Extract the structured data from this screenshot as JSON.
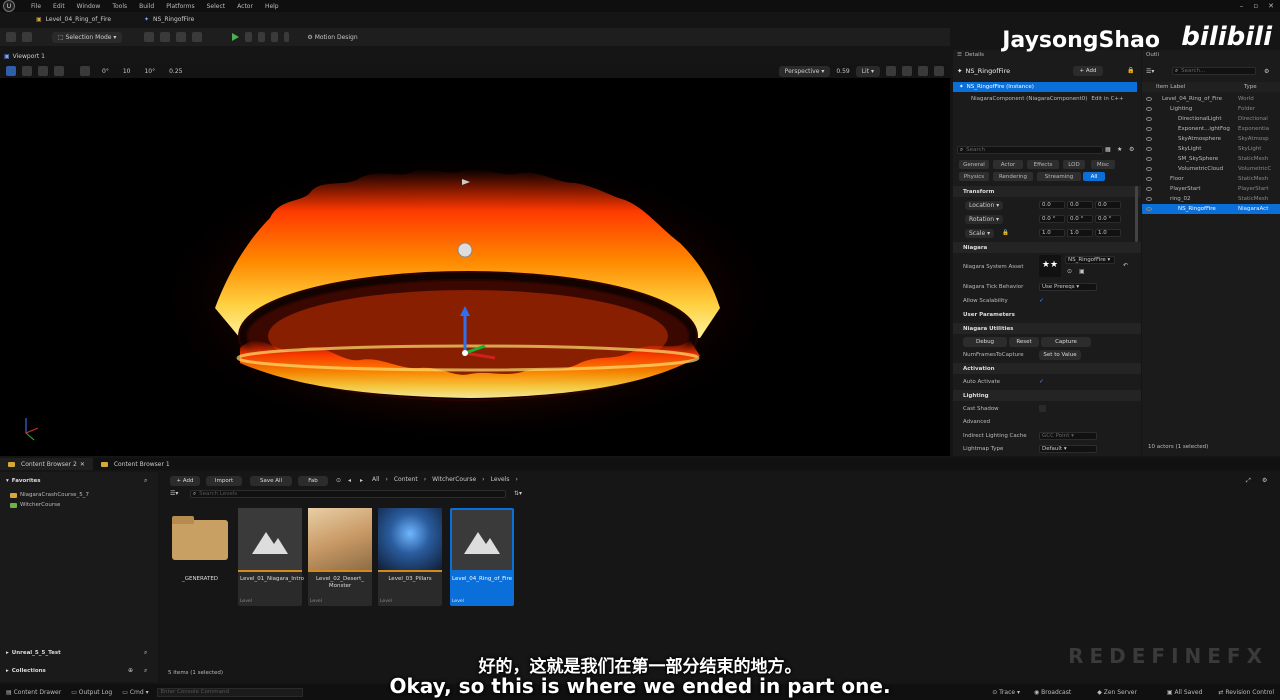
{
  "menu": [
    "File",
    "Edit",
    "Window",
    "Tools",
    "Build",
    "Platforms",
    "Select",
    "Actor",
    "Help"
  ],
  "window_tabs": [
    "Level_04_Ring_of_Fire",
    "NS_RingofFire"
  ],
  "toolbar": {
    "mode": "Selection Mode",
    "motion_design": "Motion Design"
  },
  "viewport": {
    "tab": "Viewport 1",
    "perspective": "Perspective",
    "fov": "0.59",
    "lit": "Lit",
    "snap_grid": "10",
    "snap_rot": "10°",
    "snap_scale": "0.25",
    "grid_val": "0°"
  },
  "details": {
    "tab": "Details",
    "object": "NS_RingofFire",
    "add": "+ Add",
    "instance": "NS_RingofFire (Instance)",
    "component": "NiagaraComponent (NiagaraComponent0)",
    "edit_in_cpp": "Edit in C++",
    "search_placeholder": "Search",
    "filters_row1": [
      "General",
      "Actor",
      "Effects",
      "LOD",
      "Misc"
    ],
    "filters_row2": [
      "Physics",
      "Rendering",
      "Streaming",
      "All"
    ],
    "transform_label": "Transform",
    "location": "Location",
    "rotation": "Rotation",
    "scale": "Scale",
    "loc_vals": [
      "0.0",
      "0.0",
      "0.0"
    ],
    "rot_vals": [
      "0.0 °",
      "0.0 °",
      "0.0 °"
    ],
    "scale_vals": [
      "1.0",
      "1.0",
      "1.0"
    ],
    "niagara_label": "Niagara",
    "system_asset": "Niagara System Asset",
    "system_asset_val": "NS_RingofFire",
    "tick_behavior": "Niagara Tick Behavior",
    "tick_behavior_val": "Use Prereqs",
    "allow_scalability": "Allow Scalability",
    "user_params": "User Parameters",
    "utilities": "Niagara Utilities",
    "debug": "Debug",
    "reset": "Reset",
    "capture": "Capture",
    "num_frames": "NumFramesToCapture",
    "set_to_value": "Set to Value",
    "activation": "Activation",
    "auto_activate": "Auto Activate",
    "lighting": "Lighting",
    "cast_shadow": "Cast Shadow",
    "advanced": "Advanced",
    "indirect_cache": "Indirect Lighting Cache",
    "indirect_cache_val": "GCC Point",
    "lightmap_type": "Lightmap Type",
    "lightmap_type_val": "Default"
  },
  "outliner": {
    "tab": "Outli",
    "search_placeholder": "Search...",
    "col_label": "Item Label",
    "col_type": "Type",
    "items": [
      {
        "label": "Level_04_Ring_of_Fire",
        "type": "World",
        "indent": 0
      },
      {
        "label": "Lighting",
        "type": "Folder",
        "indent": 1
      },
      {
        "label": "DirectionalLight",
        "type": "Directional",
        "indent": 2
      },
      {
        "label": "Exponent...ightFog",
        "type": "Exponentia",
        "indent": 2
      },
      {
        "label": "SkyAtmosphere",
        "type": "SkyAtmosp",
        "indent": 2
      },
      {
        "label": "SkyLight",
        "type": "SkyLight",
        "indent": 2
      },
      {
        "label": "SM_SkySphere",
        "type": "StaticMesh",
        "indent": 2
      },
      {
        "label": "VolumetricCloud",
        "type": "VolumetricC",
        "indent": 2
      },
      {
        "label": "Floor",
        "type": "StaticMesh",
        "indent": 1
      },
      {
        "label": "PlayerStart",
        "type": "PlayerStart",
        "indent": 1
      },
      {
        "label": "ring_02",
        "type": "StaticMesh",
        "indent": 1
      },
      {
        "label": "NS_RingofFire",
        "type": "NiagaraAct",
        "indent": 2
      }
    ],
    "count": "10 actors (1 selected)"
  },
  "content_browser": {
    "tabs": [
      "Content Browser 2",
      "Content Browser 1"
    ],
    "favorites": "Favorites",
    "fav_items": [
      "NiagaraCrashCourse_5_7",
      "WitcherCourse"
    ],
    "add": "+ Add",
    "import": "Import",
    "save_all": "Save All",
    "fab": "Fab",
    "breadcrumb": [
      "All",
      "Content",
      "WitcherCourse",
      "Levels"
    ],
    "search_placeholder": "Search Levels",
    "tiles": [
      {
        "name": "_GENERATED",
        "kind": ""
      },
      {
        "name": "Level_01_Niagara_Intro",
        "kind": "Level"
      },
      {
        "name": "Level_02_Desert_ Monster",
        "kind": "Level"
      },
      {
        "name": "Level_03_Pillars",
        "kind": "Level"
      },
      {
        "name": "Level_04_Ring_of_Fire",
        "kind": "Level"
      }
    ],
    "unreal_test": "Unreal_5_5_Test",
    "collections": "Collections",
    "items_count": "5 items (1 selected)"
  },
  "statusbar": {
    "content_drawer": "Content Drawer",
    "output_log": "Output Log",
    "cmd": "Cmd",
    "console_placeholder": "Enter Console Command",
    "trace": "Trace",
    "broadcast": "Broadcast",
    "zen_server": "Zen Server",
    "all_saved": "All Saved",
    "revision_control": "Revision Control"
  },
  "overlay": {
    "watermark": "JaysongShao",
    "bili": "bilibili",
    "brand": "REDEFINEFX",
    "subtitle_cn": "好的，这就是我们在第一部分结束的地方。",
    "subtitle_en": "Okay, so this is where we ended in part one."
  },
  "colors": {
    "accent": "#0a6fd8",
    "fire": "#ff6a00",
    "play": "#4caf50"
  }
}
